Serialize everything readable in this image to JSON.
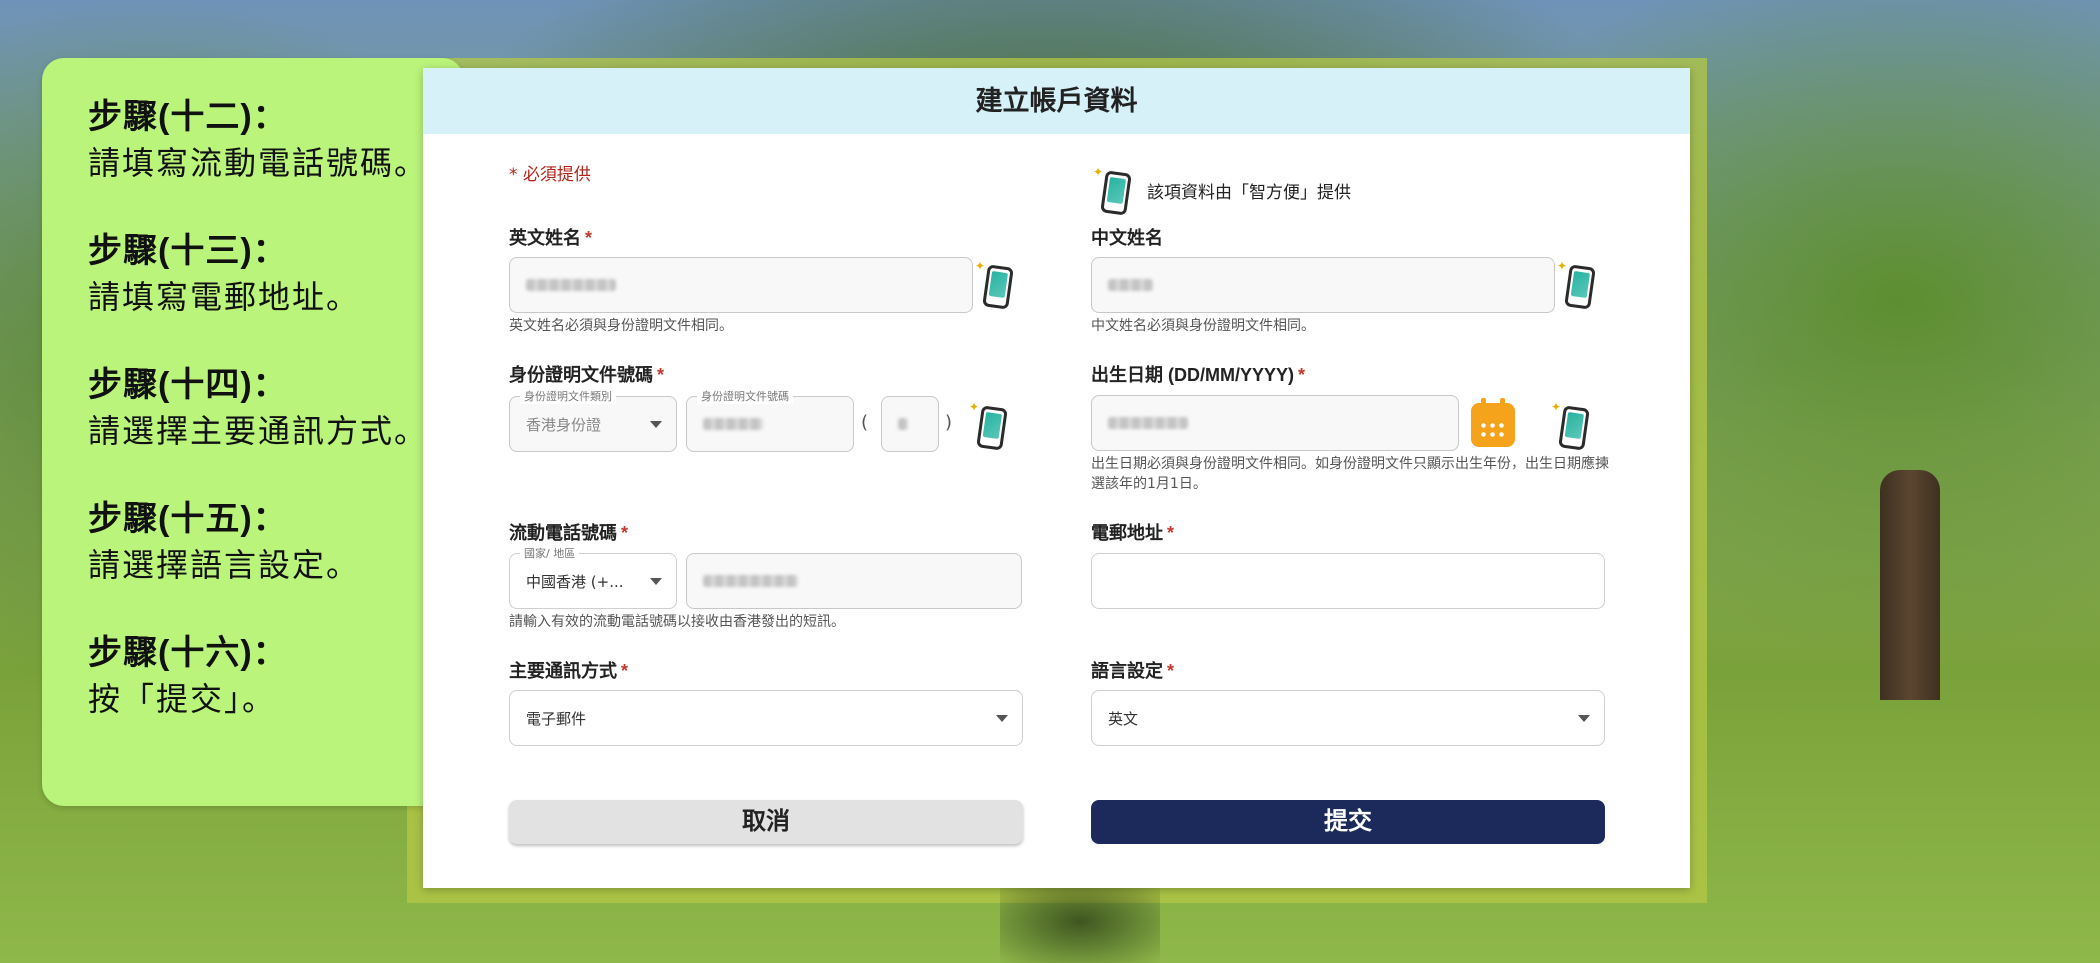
{
  "instructions": [
    {
      "title": "步驟(十二)：",
      "text": "請填寫流動電話號碼。"
    },
    {
      "title": "步驟(十三)：",
      "text": "請填寫電郵地址。"
    },
    {
      "title": "步驟(十四)：",
      "text": "請選擇主要通訊方式。"
    },
    {
      "title": "步驟(十五)：",
      "text": "請選擇語言設定。"
    },
    {
      "title": "步驟(十六)：",
      "text": "按「提交」。"
    }
  ],
  "form": {
    "title": "建立帳戶資料",
    "required_note": "* 必須提供",
    "iamsmart_note": "該項資料由「智方便」提供",
    "english_name": {
      "label": "英文姓名",
      "star": "*",
      "hint": "英文姓名必須與身份證明文件相同。"
    },
    "chinese_name": {
      "label": "中文姓名",
      "hint": "中文姓名必須與身份證明文件相同。"
    },
    "id_number": {
      "label": "身份證明文件號碼",
      "star": "*",
      "type_label": "身份證明文件類別",
      "type_value": "香港身份證",
      "number_label": "身份證明文件號碼",
      "paren_open": "(",
      "paren_close": ")"
    },
    "dob": {
      "label": "出生日期 (DD/MM/YYYY)",
      "star": "*",
      "hint": "出生日期必須與身份證明文件相同。如身份證明文件只顯示出生年份，出生日期應揀選該年的1月1日。"
    },
    "mobile": {
      "label": "流動電話號碼",
      "star": "*",
      "region_label": "國家/ 地區",
      "region_value": "中國香港 (+...",
      "hint": "請輸入有效的流動電話號碼以接收由香港發出的短訊。"
    },
    "email": {
      "label": "電郵地址",
      "star": "*",
      "value": ""
    },
    "contact_method": {
      "label": "主要通訊方式",
      "star": "*",
      "value": "電子郵件"
    },
    "language": {
      "label": "語言設定",
      "star": "*",
      "value": "英文"
    },
    "buttons": {
      "cancel": "取消",
      "submit": "提交"
    }
  },
  "colors": {
    "bubble": "#baf47a",
    "header": "#d6f1f8",
    "submit": "#1b2a5a",
    "required": "#c0392b",
    "calendar": "#f6a31c"
  }
}
